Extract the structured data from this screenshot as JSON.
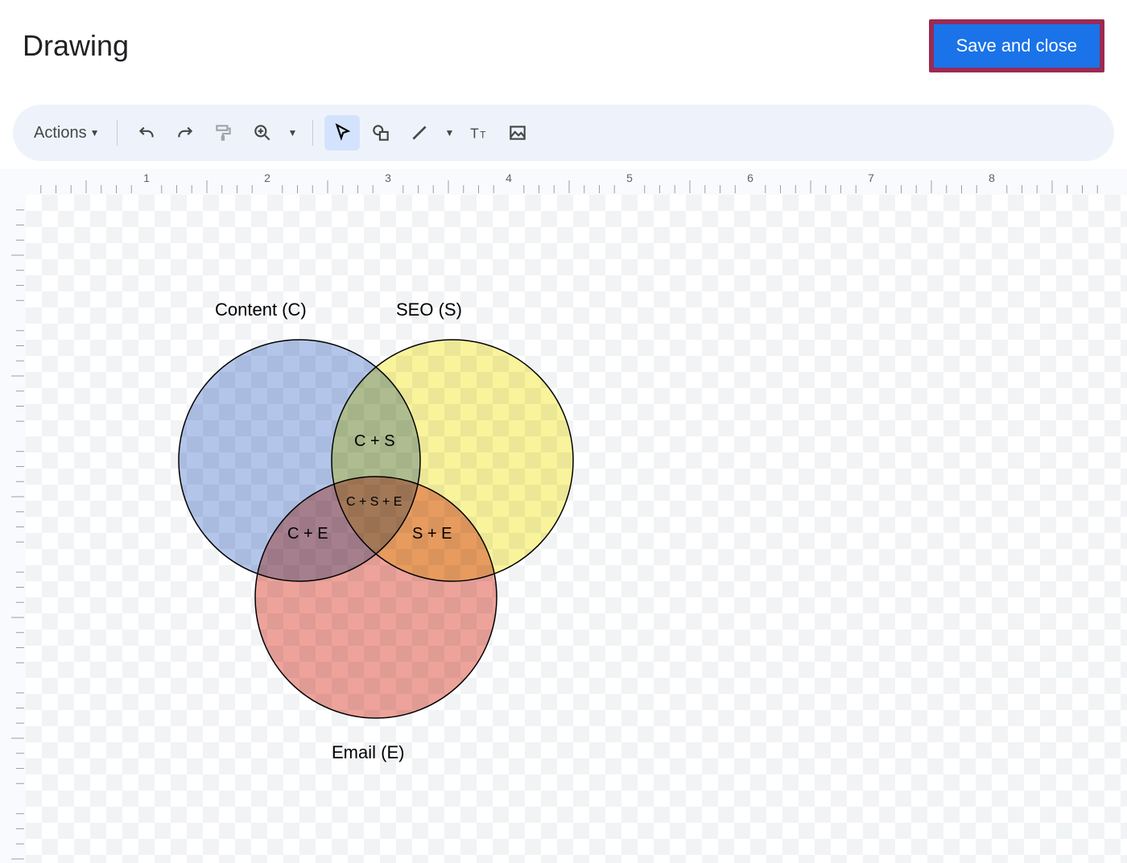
{
  "header": {
    "title": "Drawing",
    "save_label": "Save and close"
  },
  "toolbar": {
    "actions_label": "Actions"
  },
  "ruler": {
    "marks": [
      "1",
      "2",
      "3",
      "4",
      "5",
      "6",
      "7",
      "8"
    ]
  },
  "venn": {
    "circles": [
      {
        "name": "content",
        "label": "Content (C)",
        "color": "#b3c6ea"
      },
      {
        "name": "seo",
        "label": "SEO (S)",
        "color": "#f9f39c"
      },
      {
        "name": "email",
        "label": "Email (E)",
        "color": "#eda39a"
      }
    ],
    "intersections": {
      "cs": "C + S",
      "ce": "C + E",
      "se": "S + E",
      "cse": "C + S + E"
    }
  }
}
